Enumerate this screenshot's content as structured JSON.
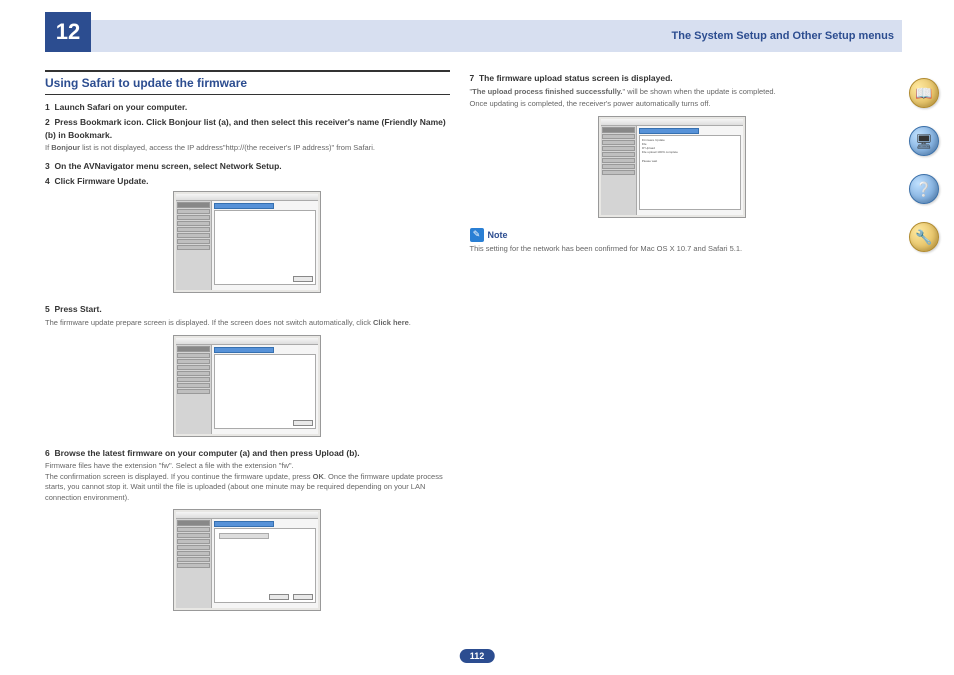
{
  "chapter_number": "12",
  "header_title": "The System Setup and Other Setup menus",
  "page_number": "112",
  "left": {
    "section_title": "Using Safari to update the firmware",
    "s1_num": "1",
    "s1_txt": "Launch Safari on your computer.",
    "s2_num": "2",
    "s2_txt": "Press Bookmark icon. Click Bonjour list (a), and then select this receiver's name (Friendly Name) (b) in Bookmark.",
    "s2_desc_a": "If ",
    "s2_desc_b": "Bonjour",
    "s2_desc_c": " list is not displayed, access the IP address\"http://(the receiver's IP address)\" from Safari.",
    "s3_num": "3",
    "s3_txt": "On the AVNavigator menu screen, select Network Setup.",
    "s4_num": "4",
    "s4_txt": "Click Firmware Update.",
    "s5_num": "5",
    "s5_txt": "Press Start.",
    "s5_desc_a": "The firmware update prepare screen is displayed. If the screen does not switch automatically, click ",
    "s5_desc_b": "Click here",
    "s5_desc_c": ".",
    "s6_num": "6",
    "s6_txt": "Browse the latest firmware on your computer (a) and then press Upload (b).",
    "s6_desc_a": "Firmware files have the extension \"fw\". Select a file with the extension \"fw\".",
    "s6_desc_b": "The confirmation screen is displayed. If you continue the firmware update, press ",
    "s6_desc_c": "OK",
    "s6_desc_d": ". Once the firmware update process starts, you cannot stop it. Wait until the file is uploaded (about one minute may be required depending on your LAN connection environment)."
  },
  "right": {
    "s7_num": "7",
    "s7_txt": "The firmware upload status screen is displayed.",
    "s7_desc_a": "\"",
    "s7_desc_b": "The upload process finished successfully.",
    "s7_desc_c": "\" will be shown when the update is completed.",
    "s7_desc2": "Once updating is completed, the receiver's power automatically turns off.",
    "note_label": "Note",
    "note_text": "This setting for the network has been confirmed for Mac OS X 10.7 and Safari 5.1."
  },
  "screenshots": {
    "sidebar_header": "Network Setup",
    "tab_label": "Firmware Update"
  },
  "side_icons": [
    {
      "name": "book-icon",
      "glyph": "📖"
    },
    {
      "name": "computer-icon",
      "glyph": "🖥"
    },
    {
      "name": "question-icon",
      "glyph": "❔"
    },
    {
      "name": "tools-icon",
      "glyph": "🔧"
    }
  ]
}
